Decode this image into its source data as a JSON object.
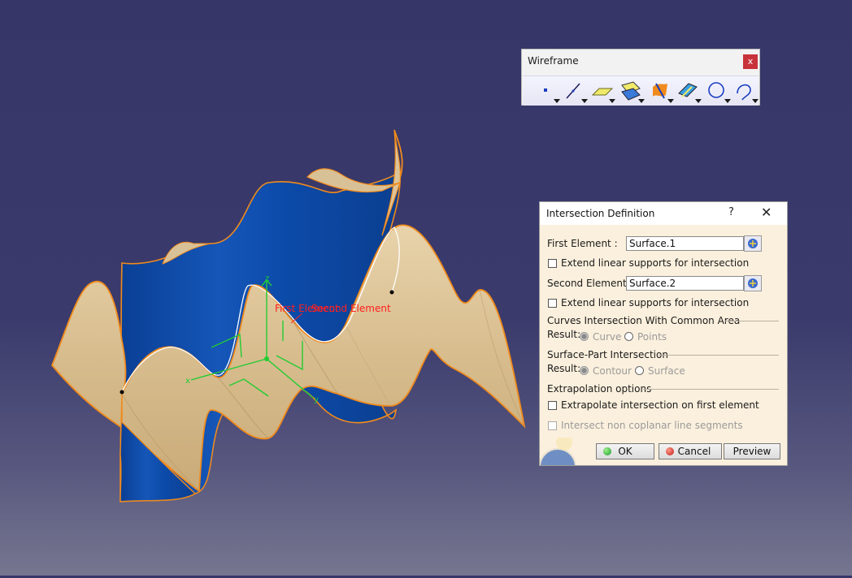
{
  "viewport": {
    "label_first_element": "First Element",
    "label_second_element": "Second Element",
    "axis_x": "x",
    "axis_y": "y",
    "axis_z": "z"
  },
  "toolbar": {
    "title": "Wireframe",
    "close_label": "x",
    "buttons": [
      {
        "name": "point-icon"
      },
      {
        "name": "line-icon"
      },
      {
        "name": "plane-icon"
      },
      {
        "name": "projection-icon"
      },
      {
        "name": "intersection-icon"
      },
      {
        "name": "offset-icon"
      },
      {
        "name": "circle-icon"
      },
      {
        "name": "spline-icon"
      }
    ]
  },
  "dialog": {
    "title": "Intersection Definition",
    "help": "?",
    "close": "✕",
    "first_element_label": "First Element :",
    "first_element_value": "Surface.1",
    "extend_1_label": "Extend linear supports for intersection",
    "second_element_label": "Second Element :",
    "second_element_value": "Surface.2",
    "extend_2_label": "Extend linear supports for intersection",
    "curves_section": "Curves Intersection With Common Area",
    "curves_result_label": "Result:",
    "curves_option_curve": "Curve",
    "curves_option_points": "Points",
    "surface_section": "Surface-Part Intersection",
    "surface_result_label": "Result:",
    "surface_option_contour": "Contour",
    "surface_option_surface": "Surface",
    "extrapolation_section": "Extrapolation options",
    "extrapolate_label": "Extrapolate intersection on first element",
    "non_coplanar_label": "Intersect non coplanar line segments",
    "ok_label": "OK",
    "cancel_label": "Cancel",
    "preview_label": "Preview"
  },
  "colors": {
    "surface_blue": "#0d4aa6",
    "surface_tan": "#dcc49a",
    "edge_orange": "#f08a1c",
    "axis_green": "#22cc33",
    "label_red": "#ff2020",
    "dialog_bg": "#fbf0dd"
  }
}
